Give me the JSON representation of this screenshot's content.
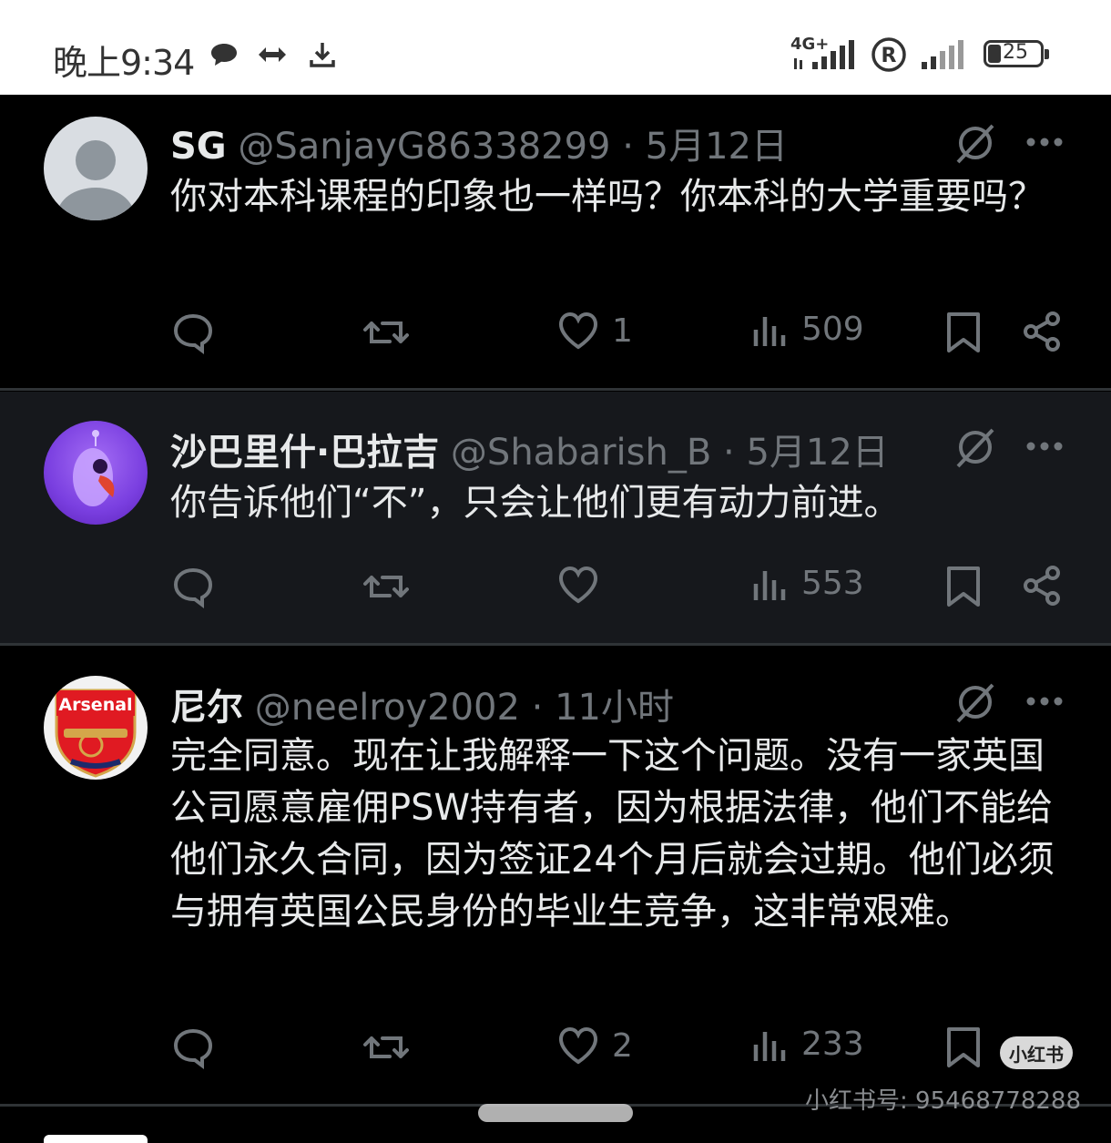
{
  "status_bar": {
    "time": "晚上9:34",
    "network": "4G+",
    "battery": "25",
    "icons": [
      "chat-bubble-icon",
      "sync-icon",
      "download-icon",
      "signal-icon",
      "roaming-r-icon",
      "signal-icon",
      "battery-icon"
    ]
  },
  "tweets": [
    {
      "name": "SG",
      "handle": "@SanjayG86338299",
      "sep": "·",
      "time": "5月12日",
      "text": "你对本科课程的印象也一样吗？你本科的大学重要吗？",
      "likes": "1",
      "views": "509",
      "avatar": "default-avatar",
      "highlighted": false
    },
    {
      "name": "沙巴里什·巴拉吉",
      "handle": "@Shabarish_B",
      "sep": "·",
      "time": "5月12日",
      "text": "你告诉他们“不”，只会让他们更有动力前进。",
      "likes": "",
      "views": "553",
      "avatar": "purple-bird-avatar",
      "highlighted": true
    },
    {
      "name": "尼尔",
      "handle": "@neelroy2002",
      "sep": "·",
      "time": "11小时",
      "text": "完全同意。现在让我解释一下这个问题。没有一家英国公司愿意雇佣PSW持有者，因为根据法律，他们不能给他们永久合同，因为签证24个月后就会过期。他们必须与拥有英国公民身份的毕业生竞争，这非常艰难。",
      "likes": "2",
      "views": "233",
      "avatar": "arsenal-crest-avatar",
      "avatar_text": "Arsenal",
      "highlighted": false
    }
  ],
  "watermark": {
    "badge": "小红书",
    "id_text": "小红书号: 95468778288"
  },
  "colors": {
    "background": "#000000",
    "highlight_bg": "#16181c",
    "text": "#e7e9ea",
    "muted": "#71767b",
    "divider": "#2f3336"
  }
}
